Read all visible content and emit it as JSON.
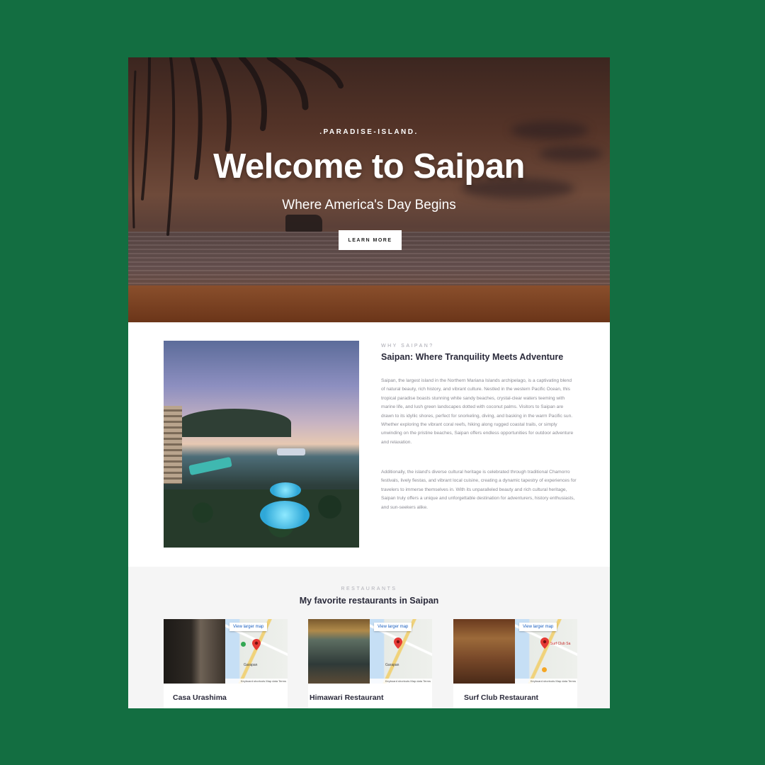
{
  "hero": {
    "eyebrow": ".PARADISE-ISLAND.",
    "title": "Welcome to Saipan",
    "subtitle": "Where America's Day Begins",
    "button_label": "LEARN MORE"
  },
  "about": {
    "label": "WHY SAIPAN?",
    "title": "Saipan: Where Tranquility Meets Adventure",
    "paragraph1": "Saipan, the largest island in the Northern Mariana Islands archipelago, is a captivating blend of natural beauty, rich history, and vibrant culture. Nestled in the western Pacific Ocean, this tropical paradise boasts stunning white sandy beaches, crystal-clear waters teeming with marine life, and lush green landscapes dotted with coconut palms. Visitors to Saipan are drawn to its idyllic shores, perfect for snorkeling, diving, and basking in the warm Pacific sun. Whether exploring the vibrant coral reefs, hiking along rugged coastal trails, or simply unwinding on the pristine beaches, Saipan offers endless opportunities for outdoor adventure and relaxation.",
    "paragraph2": "Additionally, the island's diverse cultural heritage is celebrated through traditional Chamorro festivals, lively fiestas, and vibrant local cuisine, creating a dynamic tapestry of experiences for travelers to immerse themselves in. With its unparalleled beauty and rich cultural heritage, Saipan truly offers a unique and unforgettable destination for adventurers, history enthusiasts, and sun-seekers alike."
  },
  "restaurants": {
    "label": "RESTAURANTS",
    "title": "My favorite restaurants in Saipan",
    "map_link_label": "View larger map",
    "map_footer": "Keyboard shortcuts  Map data  Terms",
    "cards": [
      {
        "name": "Casa Urashima",
        "map_place": "Garapan"
      },
      {
        "name": "Himawari Restaurant",
        "map_place": "Garapan"
      },
      {
        "name": "Surf Club Restaurant",
        "map_place": "Surf Club Sa"
      }
    ]
  },
  "colors": {
    "background": "#136e41",
    "pin_red": "#e53935"
  }
}
